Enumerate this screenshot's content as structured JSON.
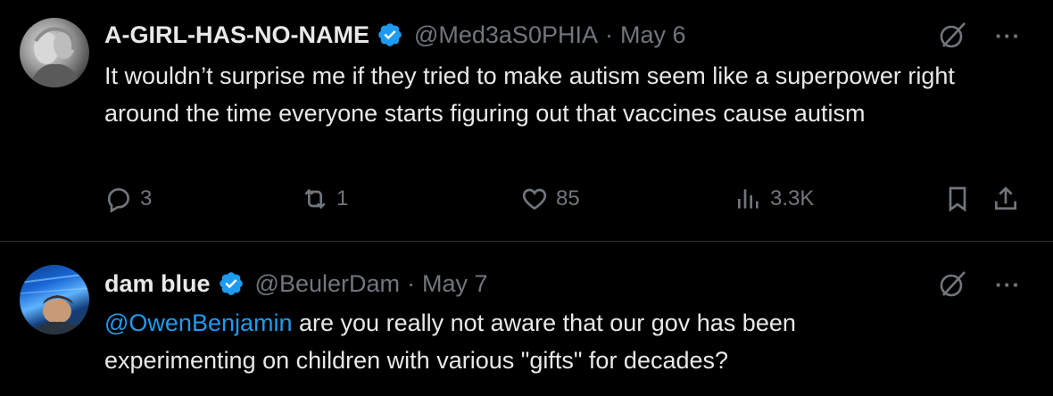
{
  "tweets": [
    {
      "name": "A-GIRL-HAS-NO-NAME",
      "handle": "@Med3aS0PHIA",
      "date": "May 6",
      "separator": "·",
      "text": "It wouldn’t surprise me if they tried to make autism seem like a superpower right around the time everyone starts figuring out that vaccines cause autism",
      "replies": "3",
      "reposts": "1",
      "likes": "85",
      "views": "3.3K"
    },
    {
      "name": "dam blue",
      "handle": "@BeulerDam",
      "date": "May 7",
      "separator": "·",
      "mention": "@OwenBenjamin",
      "text_line1": " are you really not aware that our gov has been",
      "text_line2": "experimenting on children with various \"gifts\" for decades?"
    }
  ],
  "icons": {
    "more": "···"
  },
  "colors": {
    "background": "#000000",
    "text": "#e7e9ea",
    "muted": "#71767b",
    "accent": "#1d9bf0",
    "divider": "#2f3336"
  }
}
